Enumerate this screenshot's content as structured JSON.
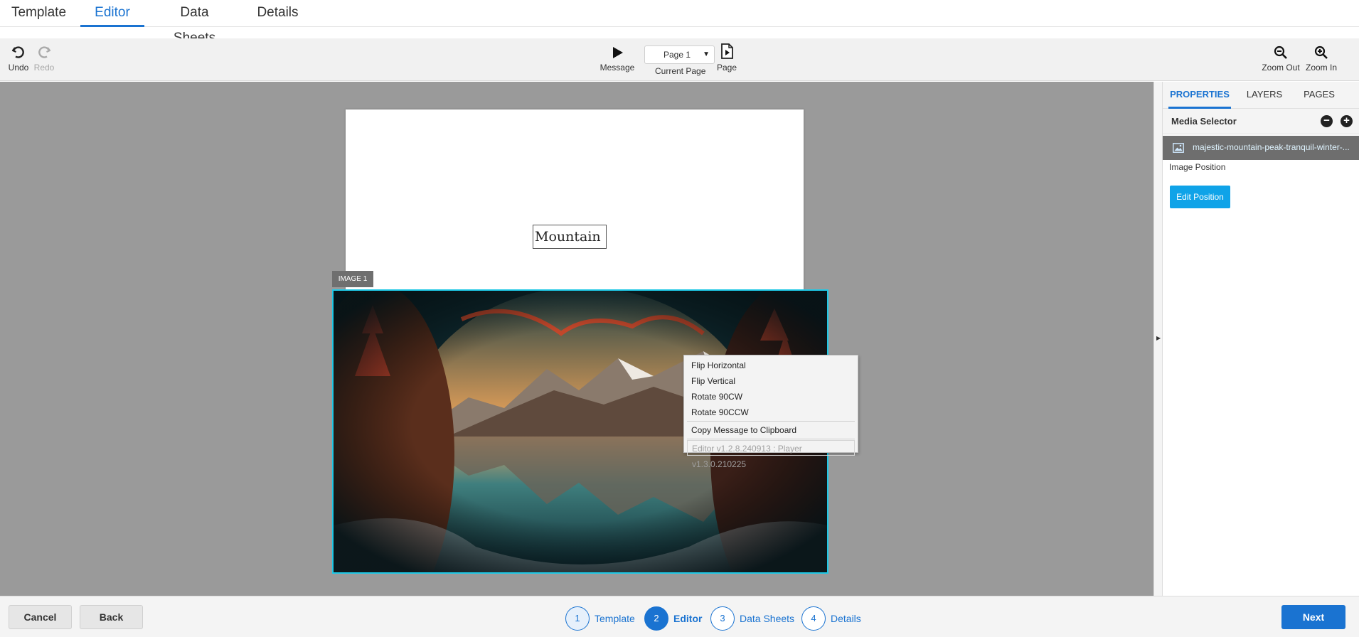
{
  "top_tabs": [
    {
      "label": "Template"
    },
    {
      "label": "Editor",
      "active": true
    },
    {
      "label": "Data Sheets"
    },
    {
      "label": "Details"
    }
  ],
  "toolbar": {
    "undo_label": "Undo",
    "redo_label": "Redo",
    "message_label": "Message",
    "page_select_value": "Page 1",
    "current_page_label": "Current Page",
    "page_label": "Page",
    "zoom_out_label": "Zoom Out",
    "zoom_in_label": "Zoom In"
  },
  "canvas": {
    "textbox_text": "Mountain",
    "image_tag": "IMAGE 1"
  },
  "context_menu": {
    "items": [
      "Flip Horizontal",
      "Flip Vertical",
      "Rotate 90CW",
      "Rotate 90CCW"
    ],
    "copy_item": "Copy Message to Clipboard",
    "version_text": "Editor v1.2.8.240913 : Player v1.3.0.210225"
  },
  "right_panel": {
    "tabs": [
      "PROPERTIES",
      "LAYERS",
      "PAGES"
    ],
    "active_tab": "PROPERTIES",
    "media_selector_title": "Media Selector",
    "media_file_name": "majestic-mountain-peak-tranquil-winter-...",
    "image_position_label": "Image Position",
    "edit_position_label": "Edit Position"
  },
  "bottom_bar": {
    "cancel_label": "Cancel",
    "back_label": "Back",
    "next_label": "Next",
    "steps": [
      {
        "num": "1",
        "label": "Template"
      },
      {
        "num": "2",
        "label": "Editor"
      },
      {
        "num": "3",
        "label": "Data Sheets"
      },
      {
        "num": "4",
        "label": "Details"
      }
    ]
  },
  "colors": {
    "accent": "#1a73d1",
    "selection": "#1ec8e6",
    "edit_button": "#0fa3e8",
    "canvas_bg": "#9a9a9a"
  }
}
